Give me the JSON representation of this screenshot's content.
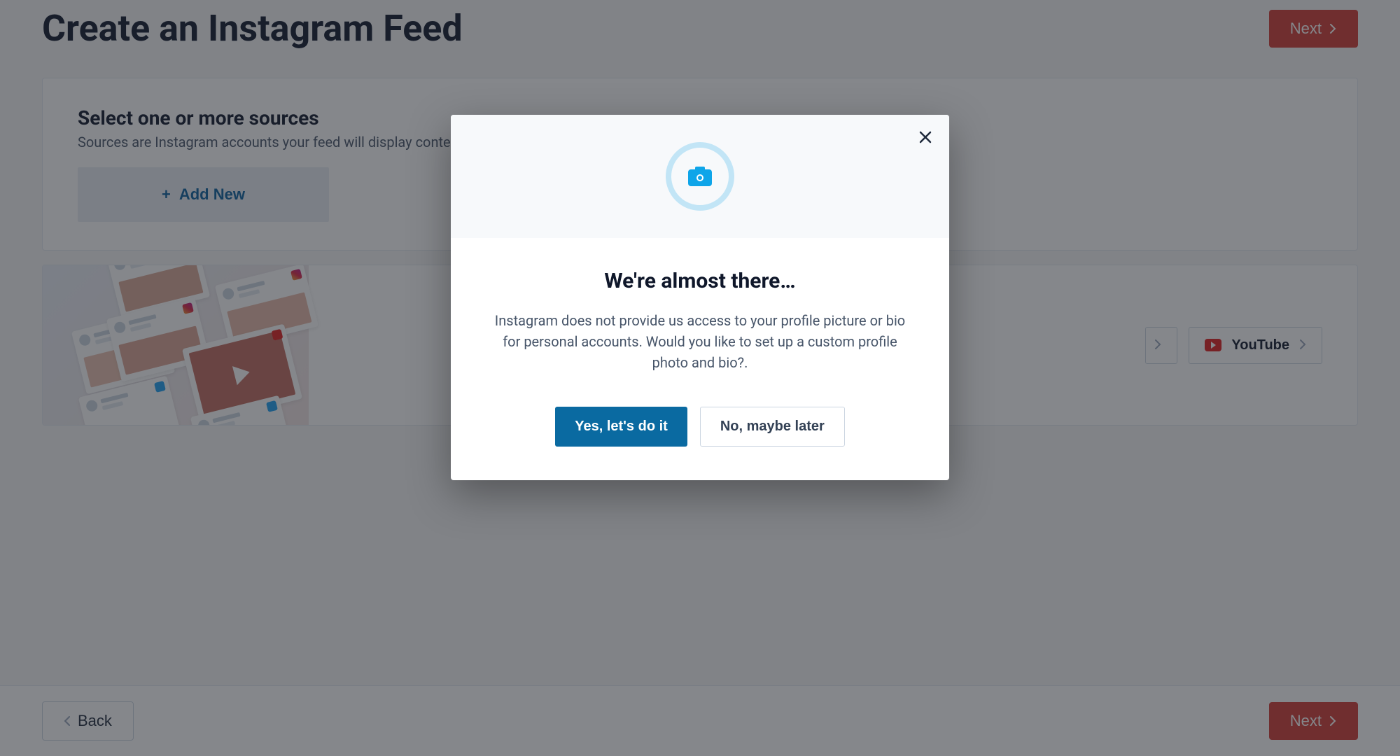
{
  "header": {
    "title": "Create an Instagram Feed",
    "next_label": "Next"
  },
  "sources": {
    "title": "Select one or more sources",
    "subtitle": "Sources are Instagram accounts your feed will display content f",
    "add_new_label": "Add New"
  },
  "promo": {
    "youtube_label": "YouTube"
  },
  "footer": {
    "back_label": "Back",
    "next_label": "Next"
  },
  "modal": {
    "title": "We're almost there…",
    "text": "Instagram does not provide us access to your profile picture or bio for personal accounts. Would you like to set up a custom profile photo and bio?.",
    "yes_label": "Yes, let's do it",
    "no_label": "No, maybe later"
  }
}
